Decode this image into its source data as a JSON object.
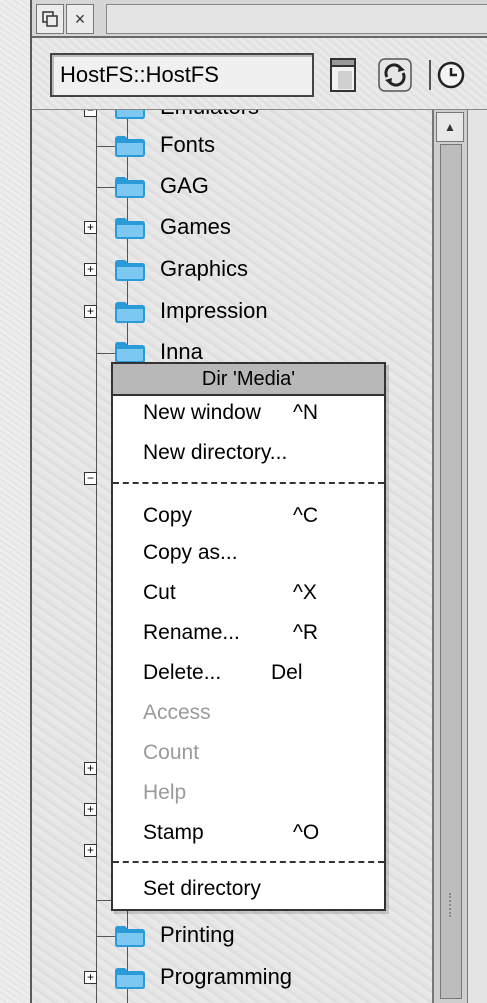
{
  "window": {
    "close_glyph": "×",
    "path": "HostFS::HostFS"
  },
  "tree": {
    "items": [
      {
        "label": "Emulators",
        "expander": "−"
      },
      {
        "label": "Fonts",
        "expander": ""
      },
      {
        "label": "GAG",
        "expander": ""
      },
      {
        "label": "Games",
        "expander": "+"
      },
      {
        "label": "Graphics",
        "expander": "+"
      },
      {
        "label": "Impression",
        "expander": "+"
      },
      {
        "label": "Inna",
        "expander": ""
      },
      {
        "label": "Printing",
        "expander": ""
      },
      {
        "label": "Programming",
        "expander": "+"
      }
    ]
  },
  "menu": {
    "title": "Dir 'Media'",
    "items": [
      {
        "label": "New window",
        "shortcut": "^N",
        "enabled": true
      },
      {
        "label": "New directory...",
        "shortcut": "",
        "enabled": true
      },
      {
        "label": "Copy",
        "shortcut": "^C",
        "enabled": true
      },
      {
        "label": "Copy as...",
        "shortcut": "",
        "enabled": true
      },
      {
        "label": "Cut",
        "shortcut": "^X",
        "enabled": true
      },
      {
        "label": "Rename...",
        "shortcut": "^R",
        "enabled": true
      },
      {
        "label": "Delete...",
        "shortcut": "Del",
        "enabled": true
      },
      {
        "label": "Access",
        "shortcut": "",
        "enabled": false
      },
      {
        "label": "Count",
        "shortcut": "",
        "enabled": false
      },
      {
        "label": "Help",
        "shortcut": "",
        "enabled": false
      },
      {
        "label": "Stamp",
        "shortcut": "^O",
        "enabled": true
      },
      {
        "label": "Set directory",
        "shortcut": "",
        "enabled": true
      }
    ]
  },
  "colors": {
    "folder": "#2a9ad8",
    "folder_light": "#7cc8f0",
    "menu_title_bg": "#b8b8b8",
    "disabled_text": "#9a9a9a"
  },
  "icons": {
    "toolbar": [
      "filer-window-icon",
      "refresh-icon",
      "clock-icon"
    ]
  }
}
